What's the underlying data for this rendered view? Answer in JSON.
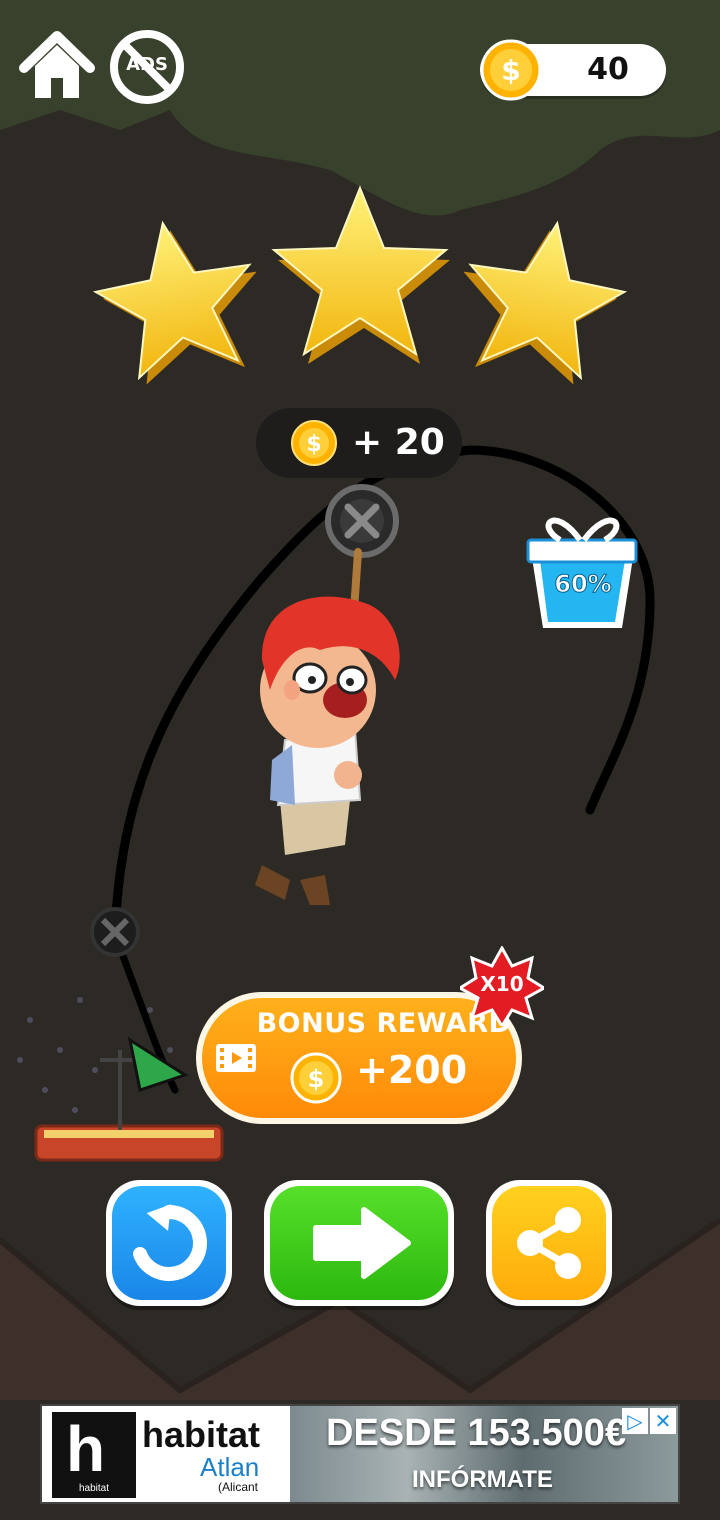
{
  "header": {
    "coins": "40",
    "home_icon": "home-icon",
    "no_ads_label": "ADS"
  },
  "level_result": {
    "stars_earned": 3,
    "stars_total": 3,
    "coin_reward": "+ 20"
  },
  "gift_box": {
    "progress_label": "60%",
    "progress": 0.6
  },
  "bonus": {
    "title": "BONUS REWARD",
    "amount": "+200",
    "multiplier": "X10"
  },
  "actions": [
    {
      "name": "restart",
      "icon": "restart-icon",
      "color": "#1e9bf0"
    },
    {
      "name": "next",
      "icon": "arrow-right-icon",
      "color": "#3ecf16"
    },
    {
      "name": "share",
      "icon": "share-icon",
      "color": "#ffbf0f"
    }
  ],
  "ad": {
    "brand": "habitat",
    "brand_sub": "Atlan",
    "location": "(Alicant",
    "logo_caption": "habitat",
    "headline": "DESDE 153.500€",
    "cta": "INFÓRMATE",
    "info_icon": "▷",
    "close_icon": "✕"
  },
  "colors": {
    "background": "#2d2a26",
    "star": "#ffd21f",
    "bonus_orange": "#ff9a10",
    "rope_line": "#000000"
  }
}
